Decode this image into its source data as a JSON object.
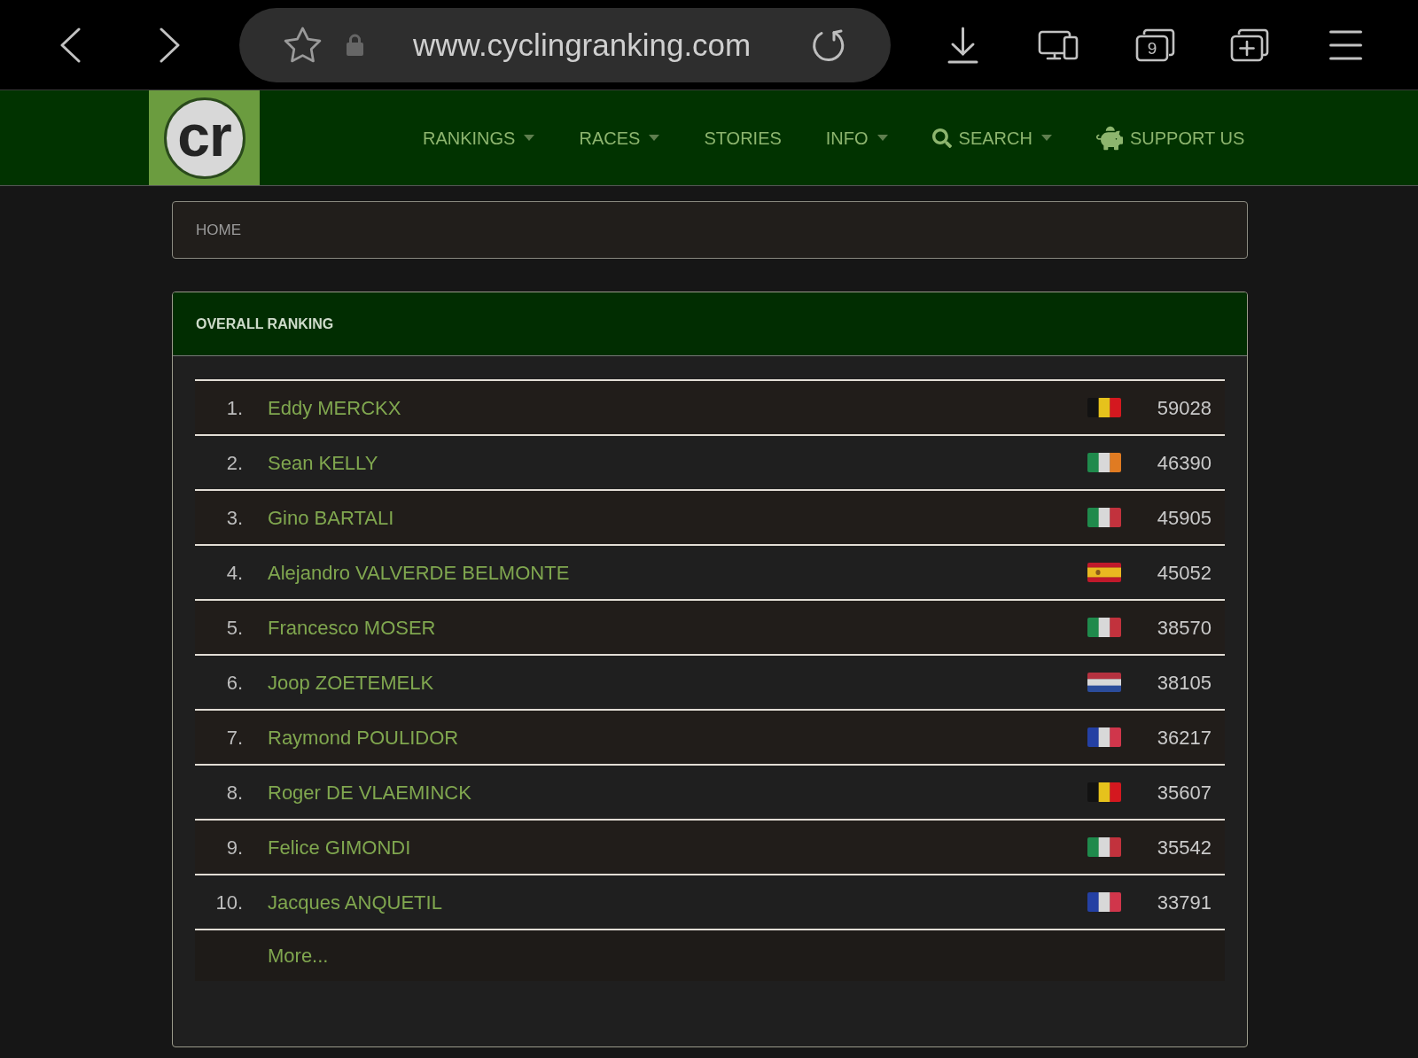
{
  "browser": {
    "url": "www.cyclingranking.com",
    "tab_count": "9"
  },
  "nav": {
    "logo": "cr",
    "items": [
      {
        "label": "RANKINGS",
        "kind": "menu"
      },
      {
        "label": "RACES",
        "kind": "menu"
      },
      {
        "label": "STORIES",
        "kind": "link"
      },
      {
        "label": "INFO",
        "kind": "menu"
      },
      {
        "label": "SEARCH",
        "kind": "search"
      },
      {
        "label": "SUPPORT US",
        "kind": "support"
      }
    ]
  },
  "breadcrumb": [
    {
      "label": "HOME"
    }
  ],
  "ranking": {
    "title": "OVERALL RANKING",
    "rows": [
      {
        "rank": "1.",
        "name": "Eddy MERCKX",
        "kind": "belgium",
        "points": "59028"
      },
      {
        "rank": "2.",
        "name": "Sean KELLY",
        "kind": "ireland",
        "points": "46390"
      },
      {
        "rank": "3.",
        "name": "Gino BARTALI",
        "kind": "italy",
        "points": "45905"
      },
      {
        "rank": "4.",
        "name": "Alejandro VALVERDE BELMONTE",
        "kind": "spain",
        "points": "45052"
      },
      {
        "rank": "5.",
        "name": "Francesco MOSER",
        "kind": "italy",
        "points": "38570"
      },
      {
        "rank": "6.",
        "name": "Joop ZOETEMELK",
        "kind": "netherlands",
        "points": "38105"
      },
      {
        "rank": "7.",
        "name": "Raymond POULIDOR",
        "kind": "france",
        "points": "36217"
      },
      {
        "rank": "8.",
        "name": "Roger DE VLAEMINCK",
        "kind": "belgium",
        "points": "35607"
      },
      {
        "rank": "9.",
        "name": "Felice GIMONDI",
        "kind": "italy",
        "points": "35542"
      },
      {
        "rank": "10.",
        "name": "Jacques ANQUETIL",
        "kind": "france",
        "points": "33791"
      }
    ],
    "more": "More..."
  }
}
